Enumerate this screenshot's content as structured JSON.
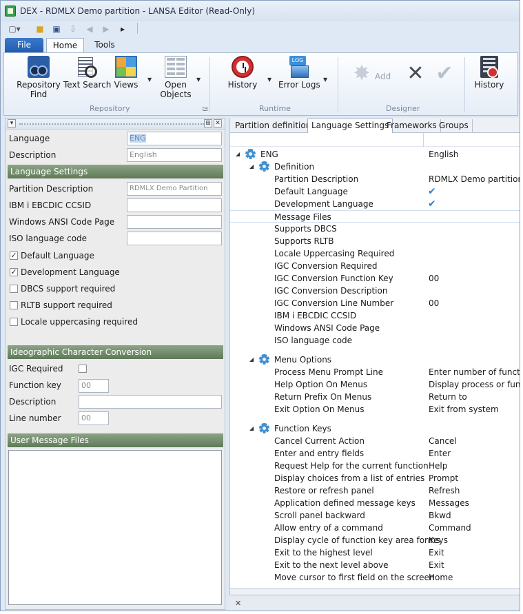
{
  "window": {
    "title": "DEX - RDMLX Demo partition - LANSA Editor (Read-Only)"
  },
  "quick_access": [
    "new-dropdown-icon",
    "open-folder-icon",
    "save-icon",
    "download-icon",
    "back-arrow-icon",
    "forward-arrow-icon",
    "more-icon"
  ],
  "ribbon_tabs": {
    "file": "File",
    "home": "Home",
    "tools": "Tools"
  },
  "ribbon": {
    "repository": {
      "group_label": "Repository",
      "find_line1": "Repository",
      "find_line2": "Find",
      "text_search": "Text Search",
      "views": "Views",
      "open_line1": "Open",
      "open_line2": "Objects"
    },
    "runtime": {
      "group_label": "Runtime",
      "history": "History",
      "error_logs": "Error Logs"
    },
    "designer": {
      "group_label": "Designer",
      "add": "Add"
    },
    "last": {
      "history": "History"
    }
  },
  "left": {
    "language_label": "Language",
    "language_value": "ENG",
    "description_label": "Description",
    "description_value": "English",
    "lang_settings_header": "Language Settings",
    "partition_desc_label": "Partition Description",
    "partition_desc_value": "RDMLX Demo Partition",
    "ibm_ccsid_label": "IBM i EBCDIC CCSID",
    "win_ansi_label": "Windows ANSI Code Page",
    "iso_label": "ISO language code",
    "cb_default_lang": "Default Language",
    "cb_dev_lang": "Development Language",
    "cb_dbcs": "DBCS support required",
    "cb_rltb": "RLTB support required",
    "cb_locale": "Locale uppercasing required",
    "igc_header": "Ideographic Character Conversion",
    "igc_required_label": "IGC Required",
    "function_key_label": "Function key",
    "function_key_value": "00",
    "igc_desc_label": "Description",
    "line_number_label": "Line number",
    "line_number_value": "00",
    "user_msg_header": "User Message Files"
  },
  "right": {
    "tabs": [
      "Partition definition",
      "Language Settings",
      "Frameworks",
      "Groups"
    ],
    "root_key": "ENG",
    "root_val": "English",
    "definition": {
      "label": "Definition",
      "rows": [
        {
          "key": "Partition Description",
          "val": "RDMLX Demo partition"
        },
        {
          "key": "Default Language",
          "val": ""
        },
        {
          "key": "Development Language",
          "val": ""
        },
        {
          "key": "Message Files",
          "val": ""
        },
        {
          "key": "Supports DBCS",
          "val": ""
        },
        {
          "key": "Supports RLTB",
          "val": ""
        },
        {
          "key": "Locale Uppercasing Required",
          "val": ""
        },
        {
          "key": "IGC Conversion Required",
          "val": ""
        },
        {
          "key": "IGC Conversion Function Key",
          "val": "00"
        },
        {
          "key": "IGC Conversion Description",
          "val": ""
        },
        {
          "key": "IGC Conversion Line Number",
          "val": "00"
        },
        {
          "key": "IBM i EBCDIC CCSID",
          "val": ""
        },
        {
          "key": "Windows ANSI Code Page",
          "val": ""
        },
        {
          "key": "ISO language code",
          "val": ""
        }
      ]
    },
    "menu_options": {
      "label": "Menu Options",
      "rows": [
        {
          "key": "Process Menu Prompt Line",
          "val": "Enter number of function"
        },
        {
          "key": "Help Option On Menus",
          "val": "Display process or function"
        },
        {
          "key": "Return Prefix On Menus",
          "val": "Return to"
        },
        {
          "key": "Exit Option On Menus",
          "val": "Exit from system"
        }
      ]
    },
    "function_keys": {
      "label": "Function Keys",
      "rows": [
        {
          "key": "Cancel Current Action",
          "val": "Cancel"
        },
        {
          "key": "Enter and entry fields",
          "val": "Enter"
        },
        {
          "key": "Request Help for the current function",
          "val": "Help"
        },
        {
          "key": "Display choices from a list of entries",
          "val": "Prompt"
        },
        {
          "key": "Restore or refresh panel",
          "val": "Refresh"
        },
        {
          "key": "Application defined message keys",
          "val": "Messages"
        },
        {
          "key": "Scroll panel backward",
          "val": "Bkwd"
        },
        {
          "key": "Allow entry of a command",
          "val": "Command"
        },
        {
          "key": "Display cycle of function key area forms",
          "val": "Keys"
        },
        {
          "key": "Exit to the highest level",
          "val": "Exit"
        },
        {
          "key": "Exit to the next level above",
          "val": "Exit"
        },
        {
          "key": "Move cursor to first field on the screen",
          "val": "Home"
        }
      ]
    }
  },
  "colors": {
    "accent": "#2f7fd0",
    "section_header": "#6e8a67",
    "file_tab": "#2b69bd"
  }
}
